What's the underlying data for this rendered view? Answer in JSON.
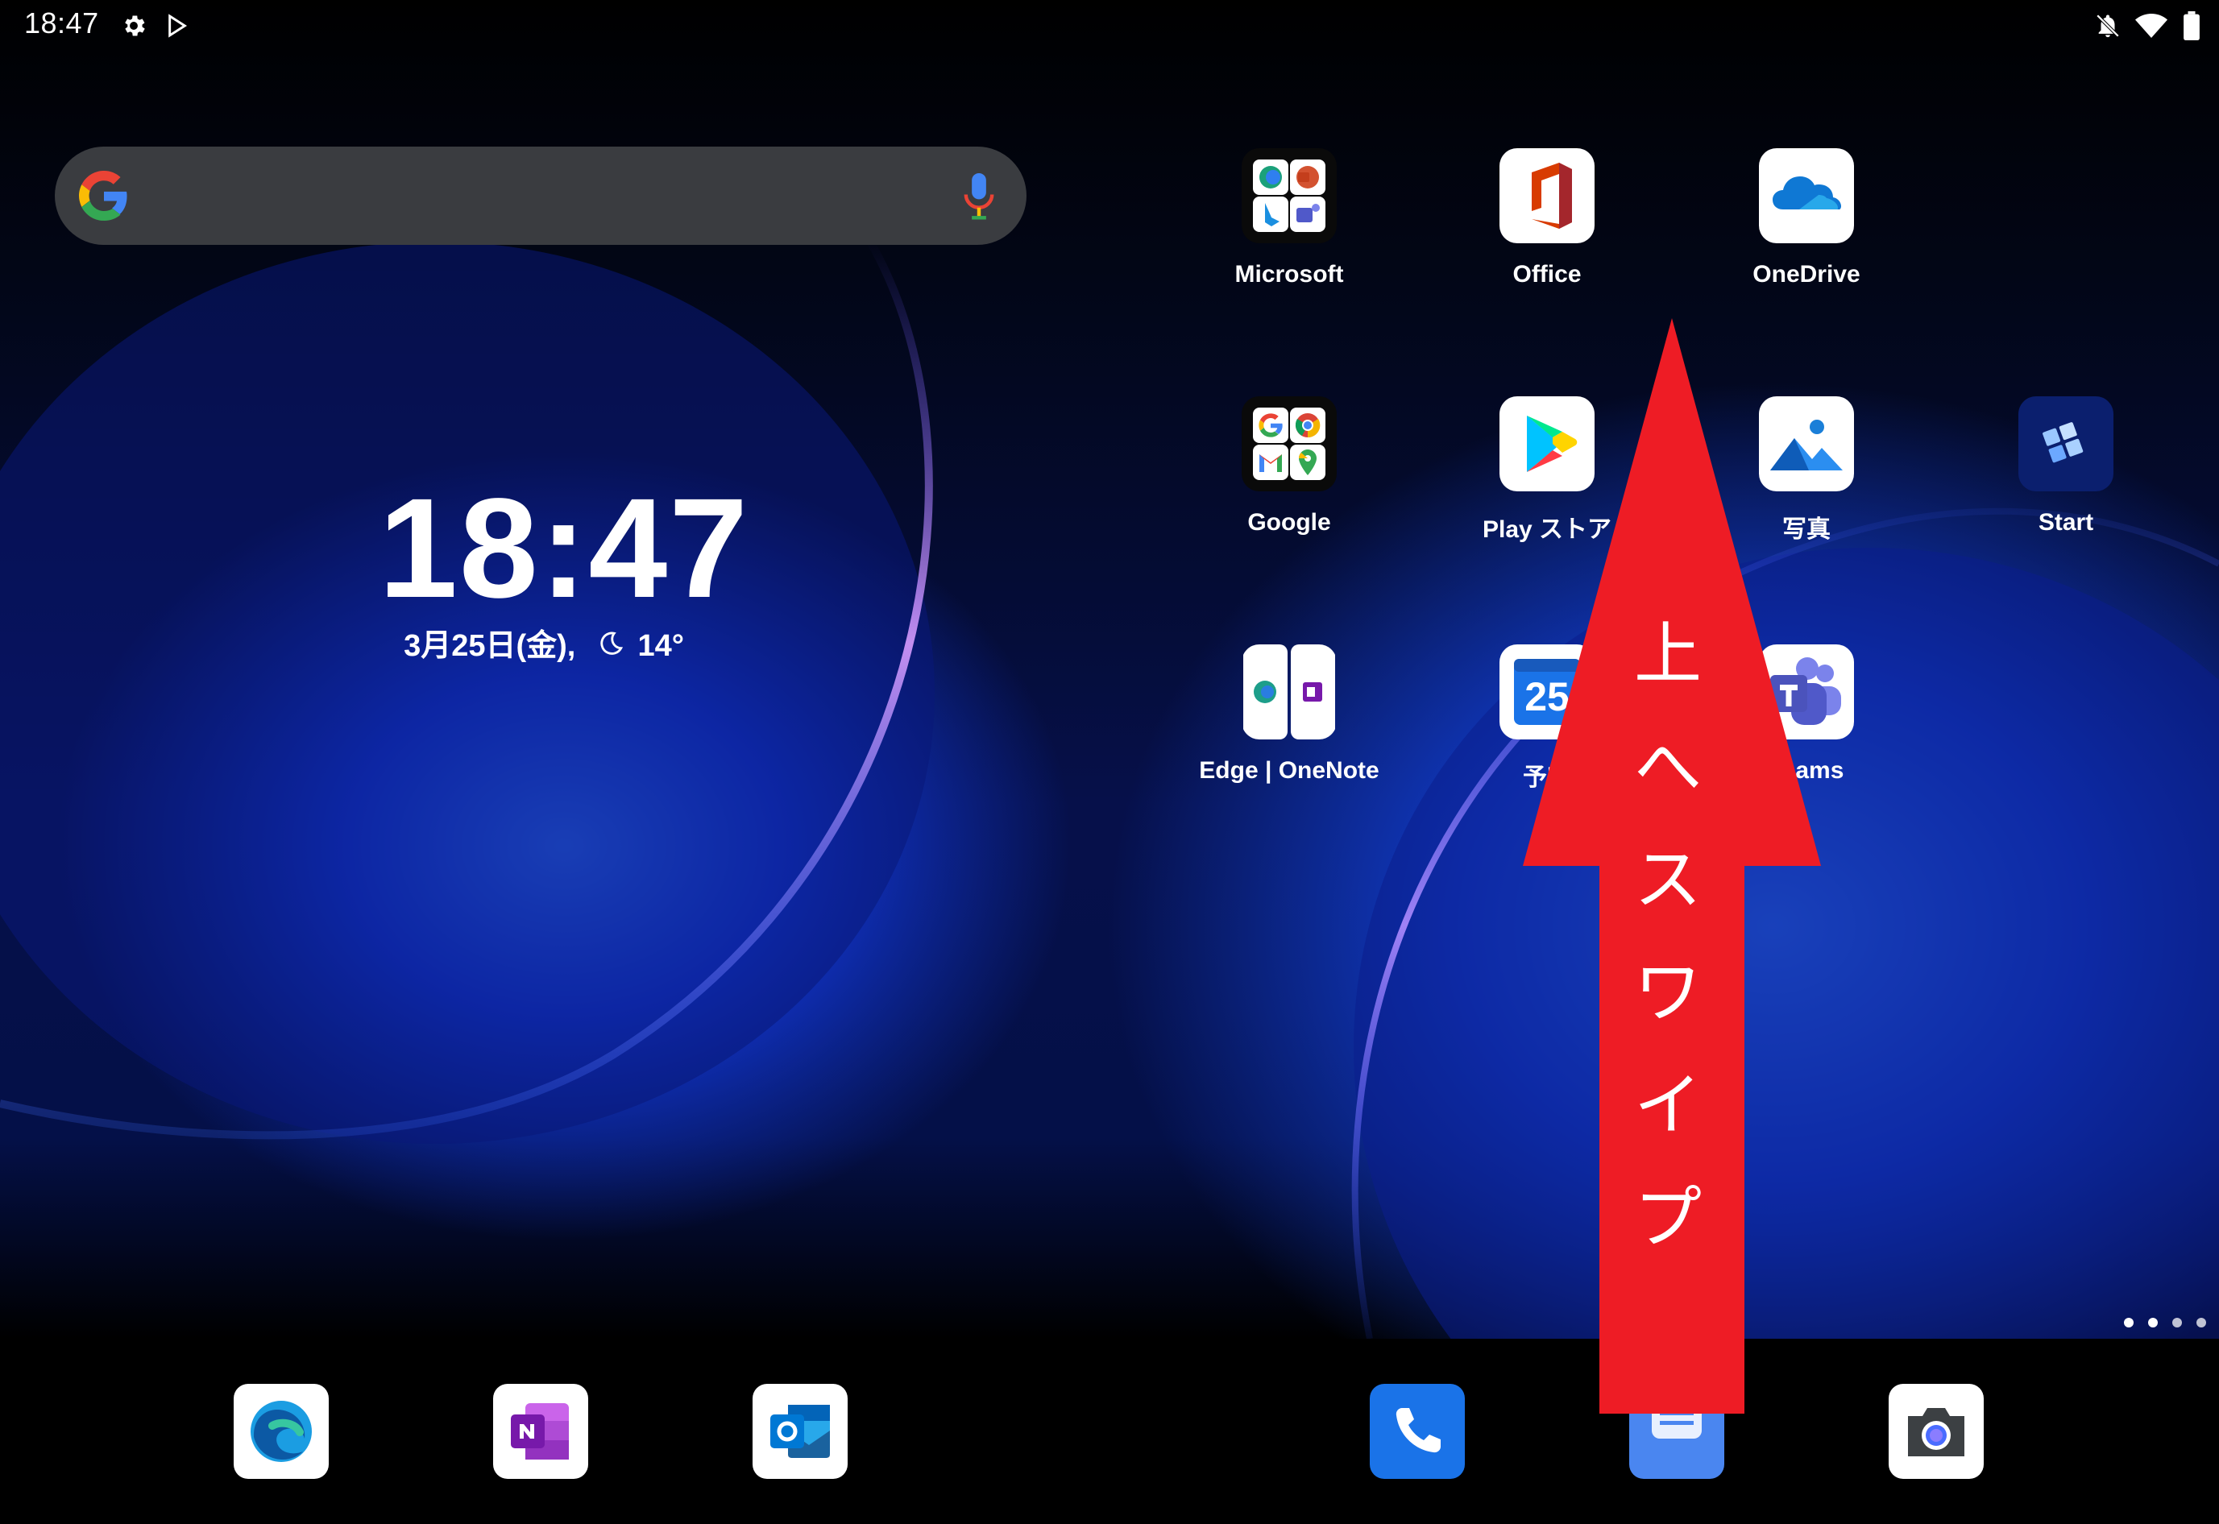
{
  "status_bar": {
    "time": "18:47",
    "left_icons": [
      "gear-icon",
      "play-store-notification-icon"
    ],
    "right_icons": [
      "notifications-off-icon",
      "wifi-icon",
      "battery-icon"
    ]
  },
  "search": {
    "icon": "google-g-logo-icon",
    "mic_icon": "microphone-icon"
  },
  "clock": {
    "time": "18:47",
    "date_weather": "3月25日(金),",
    "weather_icon": "moon-icon",
    "temperature": "14°"
  },
  "apps": [
    {
      "label": "Microsoft",
      "type": "folder"
    },
    {
      "label": "Office",
      "type": "app"
    },
    {
      "label": "OneDrive",
      "type": "app"
    },
    {
      "label": "Google",
      "type": "folder"
    },
    {
      "label": "Play ストア",
      "type": "app"
    },
    {
      "label": "写真",
      "type": "app"
    },
    {
      "label": "Start",
      "type": "app"
    },
    {
      "label": "Edge | OneNote",
      "type": "app-pair"
    },
    {
      "label": "予定",
      "type": "app",
      "icon_text": "25"
    },
    {
      "label": "Teams",
      "type": "app"
    }
  ],
  "dock": [
    "edge-icon",
    "onenote-icon",
    "outlook-icon",
    "phone-icon",
    "messages-icon",
    "camera-icon"
  ],
  "page_indicator": {
    "count": 4,
    "current": 2
  },
  "overlay": {
    "text_chars": [
      "上",
      "へ",
      "ス",
      "ワ",
      "イ",
      "プ"
    ],
    "color": "#ee1c25"
  }
}
